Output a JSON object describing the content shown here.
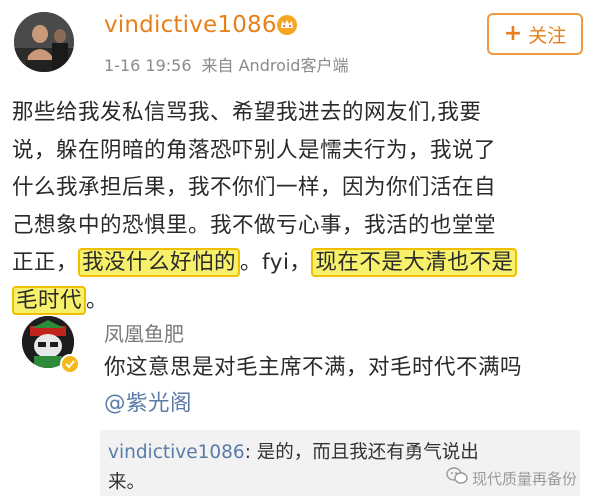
{
  "post": {
    "username": "vindictive1086",
    "timestamp": "1-16 19:56",
    "source": "来自 Android客户端",
    "follow_label": "关注",
    "body_lines": [
      [
        "那些给我发私信骂我、希望我进去的网友们,我要"
      ],
      [
        "说，躲在阴暗的角落恐吓别人是懦夫行为，我说了"
      ],
      [
        "什么我承担后果，我不你们一样，因为你们活在自"
      ],
      [
        "己想象中的恐惧里。我不做亏心事，我活的也堂堂"
      ],
      [
        "正正，",
        "我没什么好怕的",
        "。fyi，",
        "现在不是大清也不是"
      ],
      [
        "毛时代",
        "。"
      ]
    ]
  },
  "comment": {
    "username": "凤凰鱼肥",
    "text": "你这意思是对毛主席不满，对毛时代不满吗",
    "mention": "@紫光阁",
    "reply": {
      "user": "vindictive1086",
      "line1": ": 是的，而且我还有勇气说出",
      "line2": "来。"
    }
  },
  "watermark": {
    "text": "现代质量再备份"
  },
  "colors": {
    "username": "#e8801a",
    "meta": "#8a8a8a",
    "highlight": "#f7f06a",
    "highlight_border": "#f0c000",
    "mention": "#5a7ba8",
    "reply_bg": "#f2f2f2"
  }
}
